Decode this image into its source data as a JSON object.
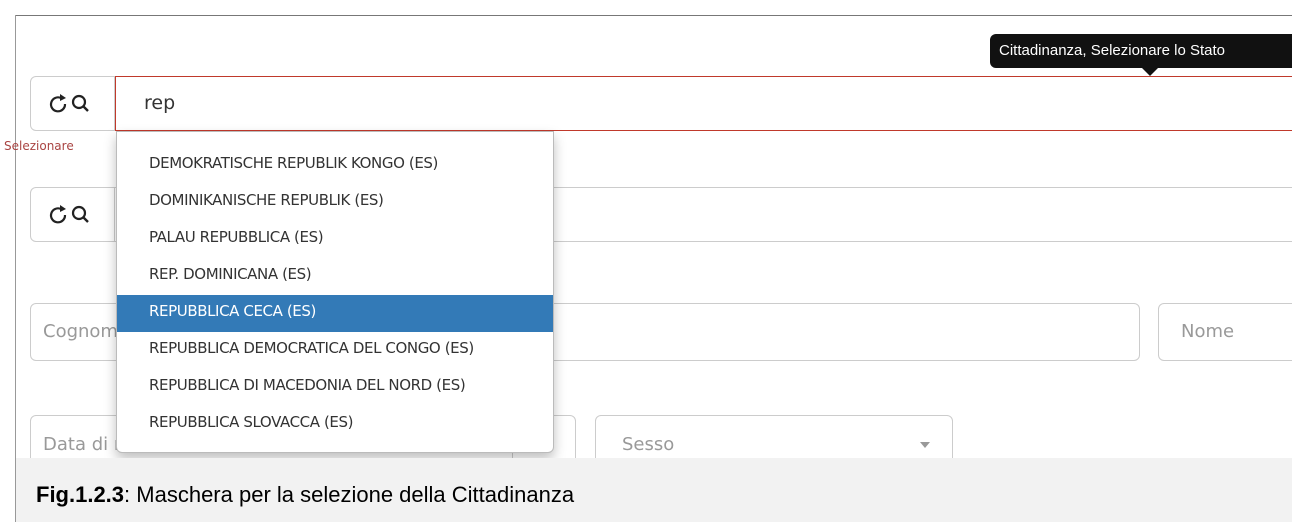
{
  "tooltip": {
    "text": "Cittadinanza, Selezionare lo Stato"
  },
  "search_main": {
    "value": "rep"
  },
  "error": {
    "text": "Selezionare"
  },
  "dropdown": {
    "items": [
      "DEMOKRATISCHE REPUBLIK KONGO (ES)",
      "DOMINIKANISCHE REPUBLIK (ES)",
      "PALAU REPUBBLICA (ES)",
      "REP. DOMINICANA (ES)",
      "REPUBBLICA CECA (ES)",
      "REPUBBLICA DEMOCRATICA DEL CONGO (ES)",
      "REPUBBLICA DI MACEDONIA DEL NORD (ES)",
      "REPUBBLICA SLOVACCA (ES)"
    ],
    "active_index": 4,
    "active_color": "#337ab7"
  },
  "fields": {
    "cognome_placeholder": "Cognome",
    "nome_placeholder": "Nome",
    "data_placeholder": "Data di nascita",
    "sesso_placeholder": "Sesso"
  },
  "icons": {
    "search": "refresh-search-icon"
  },
  "caption": {
    "label": "Fig.1.2.3",
    "text": ": Maschera per la selezione della Cittadinanza"
  }
}
